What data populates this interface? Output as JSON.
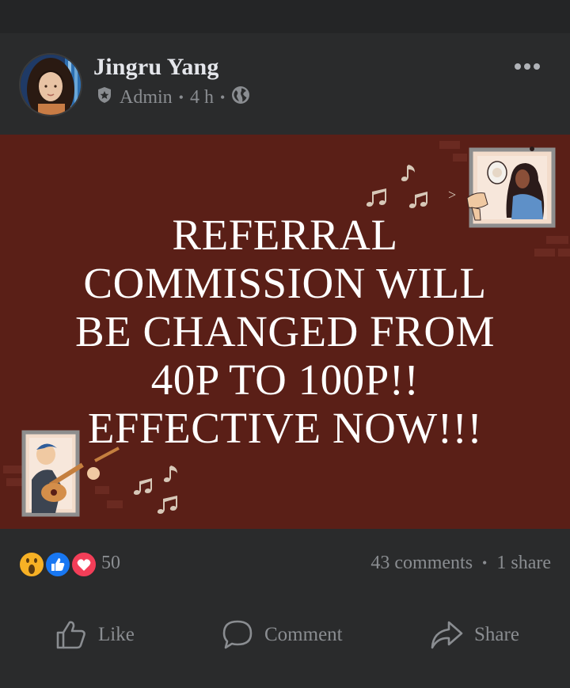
{
  "post": {
    "author": "Jingru Yang",
    "role": "Admin",
    "time": "4 h",
    "separator": "•",
    "privacy_icon": "globe-icon",
    "more_icon": "more-options-icon"
  },
  "banner": {
    "background": "#5a1f17",
    "lines": [
      "REFERRAL",
      "COMMISSION WILL",
      "BE CHANGED FROM",
      "40P TO 100P!!",
      "EFFECTIVE NOW!!!"
    ]
  },
  "stats": {
    "reaction_icons": [
      "wow-icon",
      "like-icon",
      "love-icon"
    ],
    "reaction_count": "50",
    "comments": "43 comments",
    "separator": "•",
    "shares": "1 share"
  },
  "actions": {
    "like": "Like",
    "comment": "Comment",
    "share": "Share"
  },
  "colors": {
    "card": "#2a2b2c",
    "text_muted": "#8a8d91",
    "like_blue": "#1877f2",
    "love_red": "#f33e58",
    "wow_yellow": "#f7b125"
  }
}
